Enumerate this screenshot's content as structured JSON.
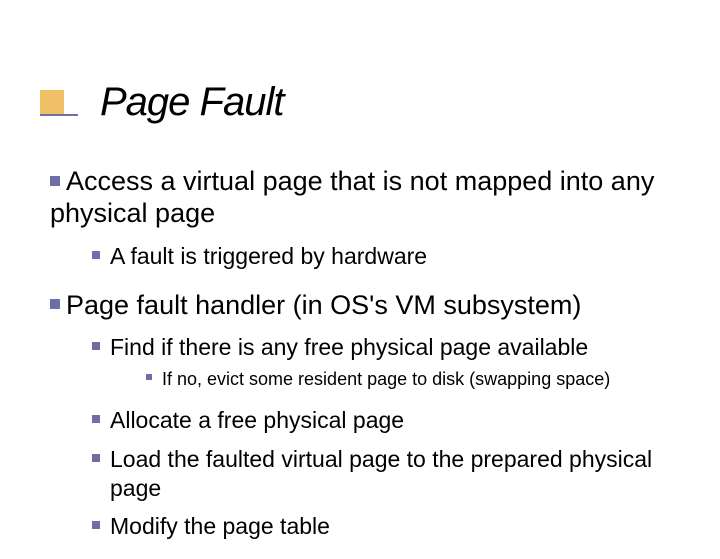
{
  "title": "Page Fault",
  "accent_color": "#f0c068",
  "bullet_color": "#6e6ea8",
  "bullets": [
    {
      "text": "Access a virtual page that is not mapped into any physical page",
      "children": [
        {
          "text": "A fault is triggered by hardware"
        }
      ]
    },
    {
      "text": "Page fault handler (in OS's VM subsystem)",
      "children": [
        {
          "text": "Find if there is any free physical page available",
          "children": [
            {
              "text": "If no, evict some resident page to disk (swapping space)"
            }
          ]
        },
        {
          "text": "Allocate a free physical page"
        },
        {
          "text": "Load the faulted virtual page to the prepared physical page"
        },
        {
          "text": "Modify the page table"
        }
      ]
    }
  ]
}
